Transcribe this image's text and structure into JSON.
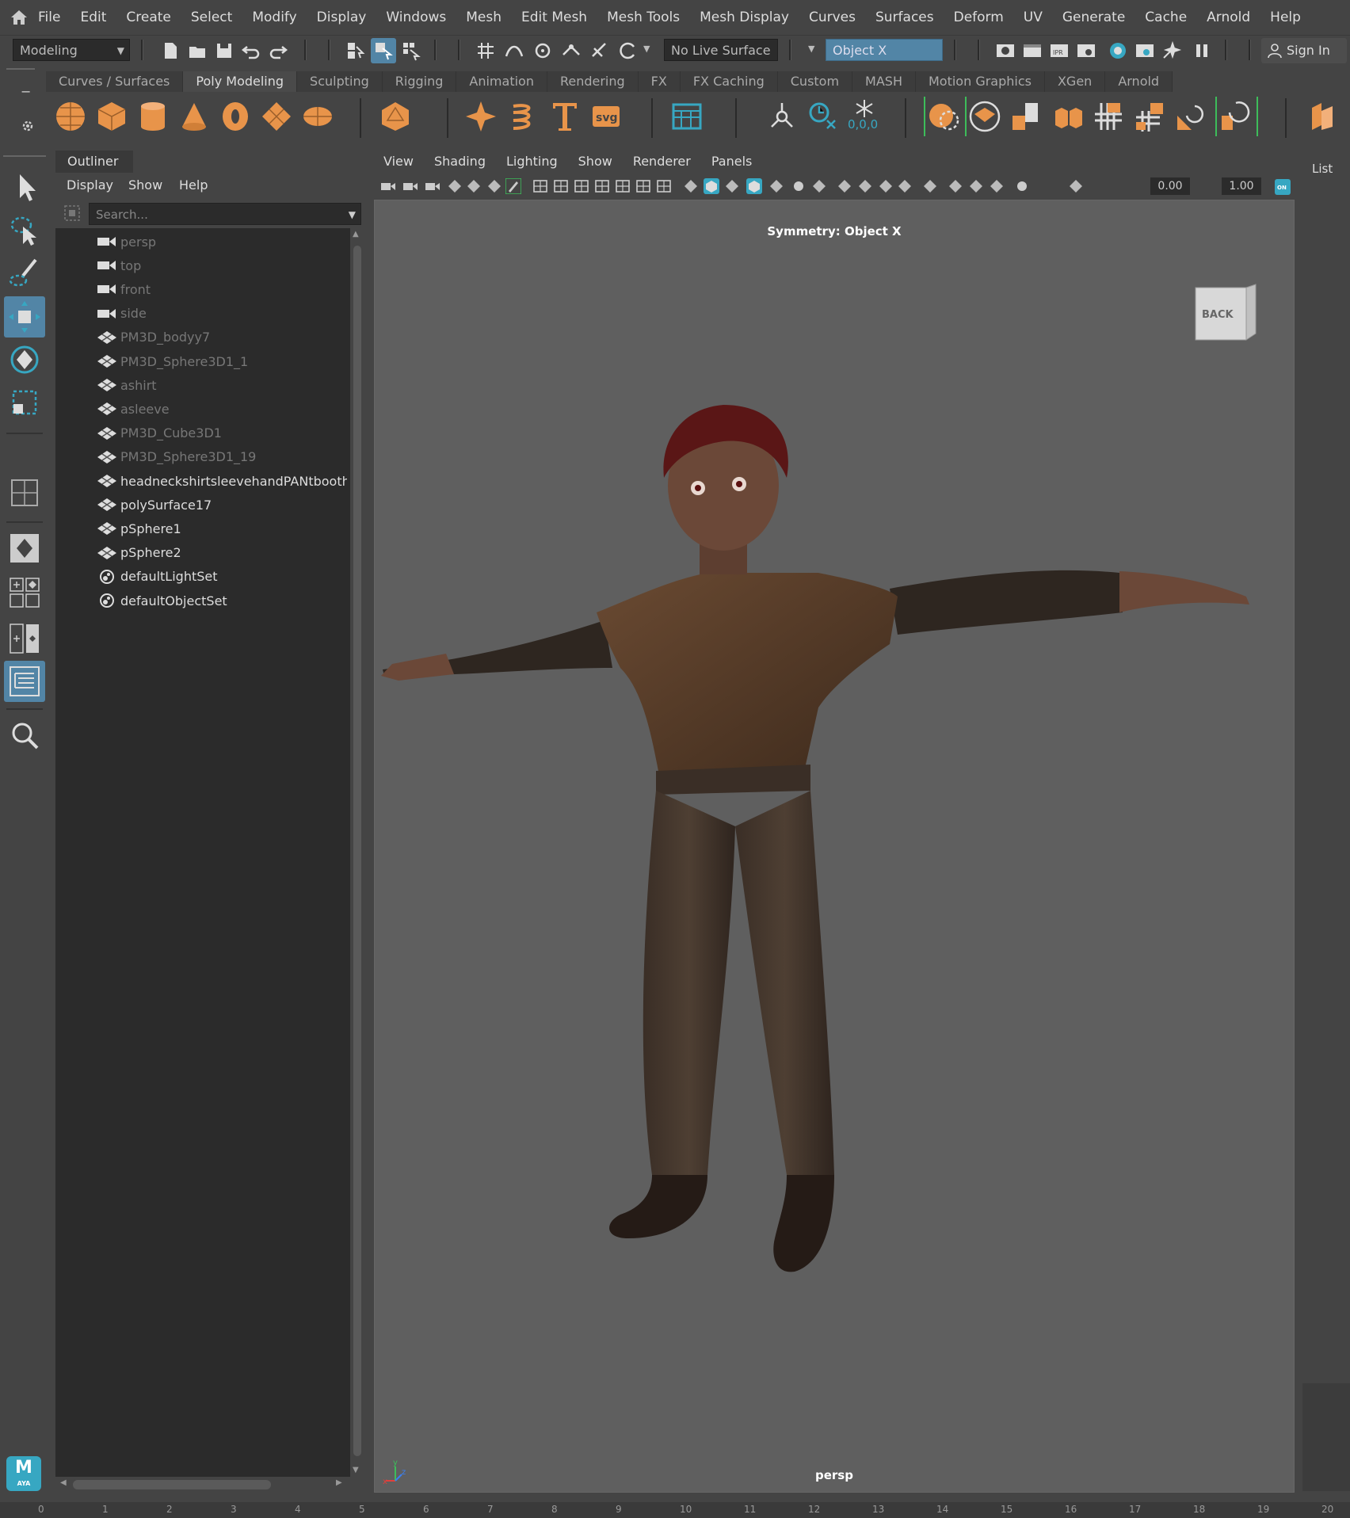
{
  "menubar": {
    "items": [
      "File",
      "Edit",
      "Create",
      "Select",
      "Modify",
      "Display",
      "Windows",
      "Mesh",
      "Edit Mesh",
      "Mesh Tools",
      "Mesh Display",
      "Curves",
      "Surfaces",
      "Deform",
      "UV",
      "Generate",
      "Cache",
      "Arnold",
      "Help"
    ]
  },
  "statusline": {
    "mode": "Modeling",
    "live_surface": "No Live Surface",
    "symmetry": "Object X",
    "sign_in": "Sign In"
  },
  "shelf": {
    "tabs": [
      "Curves / Surfaces",
      "Poly Modeling",
      "Sculpting",
      "Rigging",
      "Animation",
      "Rendering",
      "FX",
      "FX Caching",
      "Custom",
      "MASH",
      "Motion Graphics",
      "XGen",
      "Arnold"
    ],
    "active_tab": "Poly Modeling",
    "counter_text": "0,0,0"
  },
  "outliner": {
    "title": "Outliner",
    "menu": [
      "Display",
      "Show",
      "Help"
    ],
    "search_placeholder": "Search...",
    "items": [
      {
        "label": "persp",
        "type": "camera",
        "dim": true
      },
      {
        "label": "top",
        "type": "camera",
        "dim": true
      },
      {
        "label": "front",
        "type": "camera",
        "dim": true
      },
      {
        "label": "side",
        "type": "camera",
        "dim": true
      },
      {
        "label": "PM3D_bodyy7",
        "type": "mesh",
        "dim": true
      },
      {
        "label": "PM3D_Sphere3D1_1",
        "type": "mesh",
        "dim": true
      },
      {
        "label": "ashirt",
        "type": "mesh",
        "dim": true
      },
      {
        "label": "asleeve",
        "type": "mesh",
        "dim": true
      },
      {
        "label": "PM3D_Cube3D1",
        "type": "mesh",
        "dim": true
      },
      {
        "label": "PM3D_Sphere3D1_19",
        "type": "mesh",
        "dim": true
      },
      {
        "label": "headneckshirtsleevehandPANtboothairsa",
        "type": "mesh",
        "dim": false
      },
      {
        "label": "polySurface17",
        "type": "mesh",
        "dim": false
      },
      {
        "label": "pSphere1",
        "type": "mesh",
        "dim": false
      },
      {
        "label": "pSphere2",
        "type": "mesh",
        "dim": false
      },
      {
        "label": "defaultLightSet",
        "type": "set",
        "dim": false
      },
      {
        "label": "defaultObjectSet",
        "type": "set",
        "dim": false
      }
    ]
  },
  "viewport": {
    "menu": [
      "View",
      "Shading",
      "Lighting",
      "Show",
      "Renderer",
      "Panels"
    ],
    "field_a": "0.00",
    "field_b": "1.00",
    "symmetry_label": "Symmetry: Object X",
    "camera_label": "persp",
    "viewcube_label": "BACK",
    "axis_x": "x",
    "axis_y": "y",
    "axis_z": "z"
  },
  "right_panel": {
    "label": "List"
  },
  "timeline": {
    "ticks": [
      "0",
      "1",
      "2",
      "3",
      "4",
      "5",
      "6",
      "7",
      "8",
      "9",
      "10",
      "11",
      "12",
      "13",
      "14",
      "15",
      "16",
      "17",
      "18",
      "19",
      "20"
    ]
  },
  "logo": {
    "text": "M",
    "sub": "AYA"
  },
  "colors": {
    "accent_orange": "#e8944a",
    "highlight_blue": "#5285a6",
    "teal": "#37a7c2",
    "green": "#3dbd5a"
  }
}
